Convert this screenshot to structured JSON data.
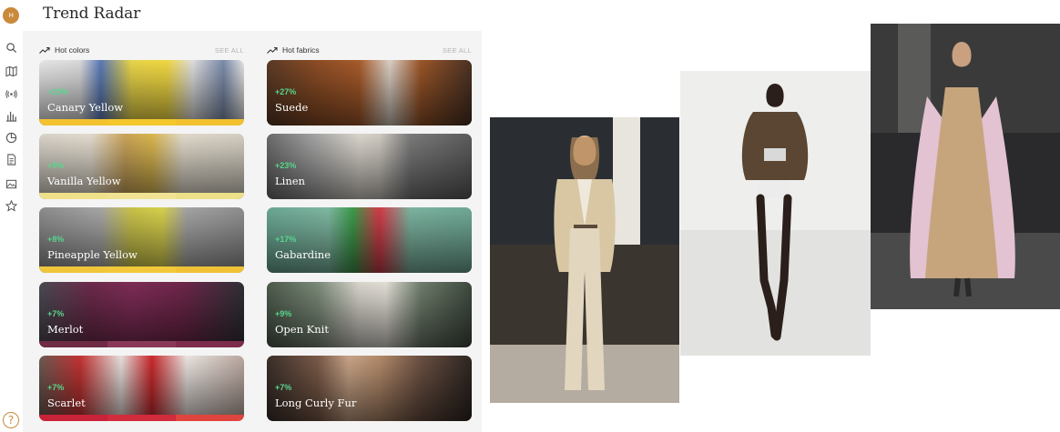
{
  "app": {
    "logo_text": "H",
    "page_title": "Trend Radar",
    "help_label": "?"
  },
  "rail_icons": [
    "search-icon",
    "map-icon",
    "broadcast-icon",
    "bar-chart-icon",
    "pie-chart-icon",
    "document-icon",
    "image-icon",
    "star-icon"
  ],
  "hot_colors": {
    "label": "Hot colors",
    "see_all": "SEE ALL",
    "items": [
      {
        "pct": "+10%",
        "name": "Canary Yellow",
        "swatch": "#f2c230"
      },
      {
        "pct": "+9%",
        "name": "Vanilla Yellow",
        "swatch": "#efe08a"
      },
      {
        "pct": "+8%",
        "name": "Pineapple Yellow",
        "swatch": "#f0c53a"
      },
      {
        "pct": "+7%",
        "name": "Merlot",
        "swatch": "#7d2c4d"
      },
      {
        "pct": "+7%",
        "name": "Scarlet",
        "swatch": "#c9233a"
      }
    ]
  },
  "hot_fabrics": {
    "label": "Hot fabrics",
    "see_all": "SEE ALL",
    "items": [
      {
        "pct": "+27%",
        "name": "Suede"
      },
      {
        "pct": "+23%",
        "name": "Linen"
      },
      {
        "pct": "+17%",
        "name": "Gabardine"
      },
      {
        "pct": "+9%",
        "name": "Open Knit"
      },
      {
        "pct": "+7%",
        "name": "Long Curly Fur"
      }
    ]
  },
  "runway_images": [
    "runway-look-beige-suede-jacket",
    "runway-look-brown-jacket",
    "runway-look-suede-dress"
  ]
}
